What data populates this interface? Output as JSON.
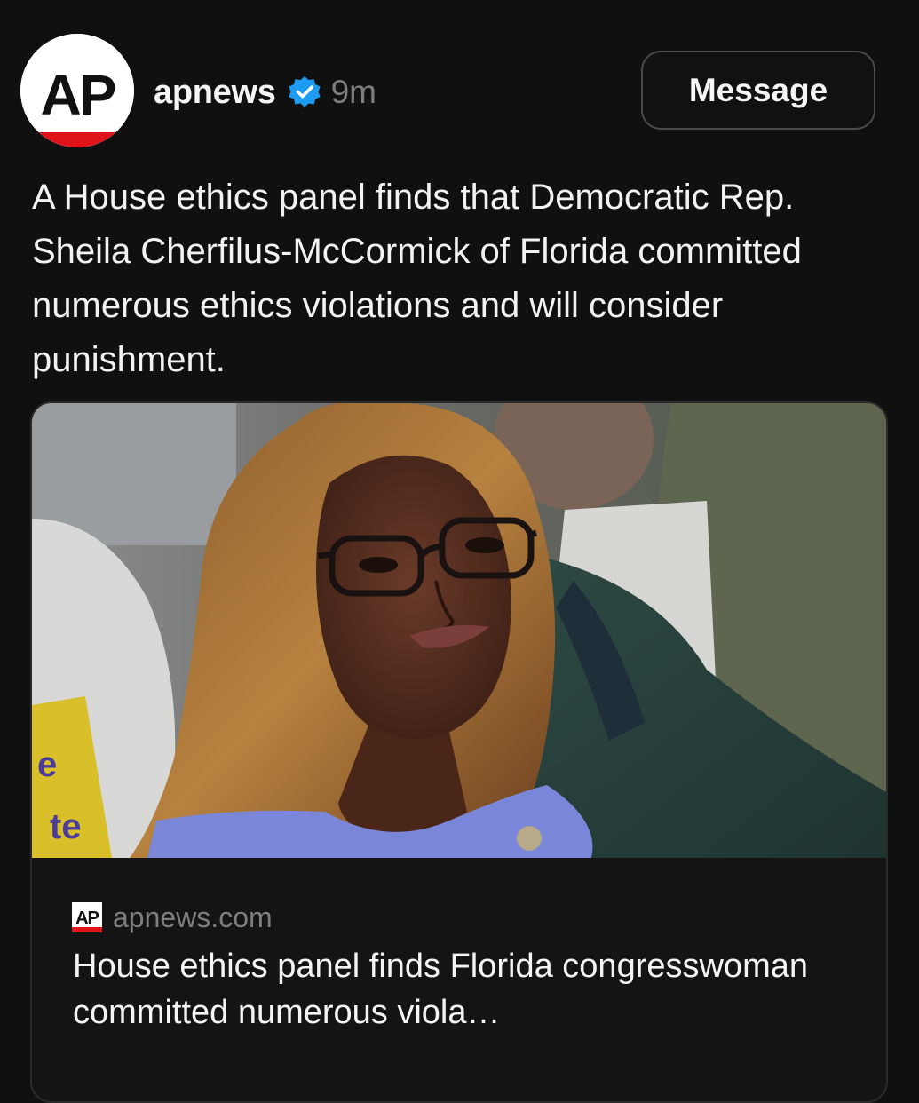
{
  "post": {
    "author": {
      "username": "apnews",
      "verified": true,
      "avatar_logo": "AP",
      "avatar_icon": "ap-logo-icon"
    },
    "timestamp": "9m",
    "message_button_label": "Message",
    "caption": "A House ethics panel finds that Democratic Rep. Sheila Cherfilus-McCormick of Florida committed numerous ethics violations and will consider punishment."
  },
  "link_card": {
    "image_icon": "news-photo",
    "source_favicon": "AP",
    "source_domain": "apnews.com",
    "title": "House ethics panel finds Florida congresswoman committed numerous viola…"
  },
  "colors": {
    "background": "#101010",
    "verified_badge": "#1d9bf0",
    "ap_red": "#e0131b",
    "muted_text": "#7d7d7d"
  }
}
